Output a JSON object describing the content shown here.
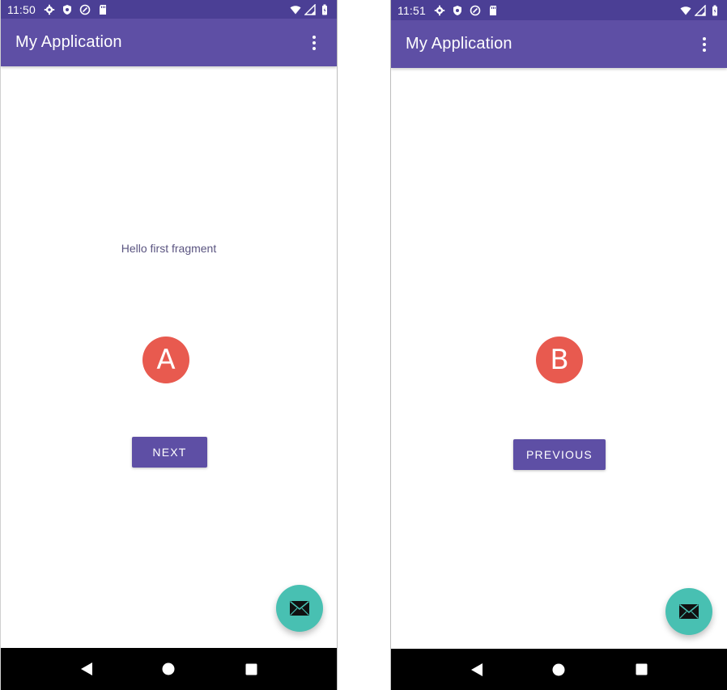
{
  "screens": [
    {
      "id": "first",
      "status": {
        "time": "11:50"
      },
      "app_bar": {
        "title": "My Application"
      },
      "content": {
        "text": "Hello first fragment",
        "marker": "A"
      },
      "button": {
        "label": "NEXT"
      },
      "fab": {
        "icon": "email-icon"
      }
    },
    {
      "id": "second",
      "status": {
        "time": "11:51"
      },
      "app_bar": {
        "title": "My Application"
      },
      "content": {
        "marker": "B"
      },
      "button": {
        "label": "PREVIOUS"
      },
      "fab": {
        "icon": "email-icon"
      }
    }
  ],
  "colors": {
    "status_bar": "#4b3f95",
    "app_bar": "#5e4fa5",
    "button": "#5e4fa5",
    "marker": "#e85a4f",
    "fab": "#48c0b2",
    "nav_bar": "#000000"
  },
  "icons": {
    "status_left": [
      "settings-icon",
      "shield-icon",
      "sync-icon",
      "sd-card-icon"
    ],
    "status_right": [
      "wifi-icon",
      "signal-icon",
      "battery-icon"
    ],
    "nav": [
      "back-icon",
      "home-icon",
      "recents-icon"
    ]
  }
}
